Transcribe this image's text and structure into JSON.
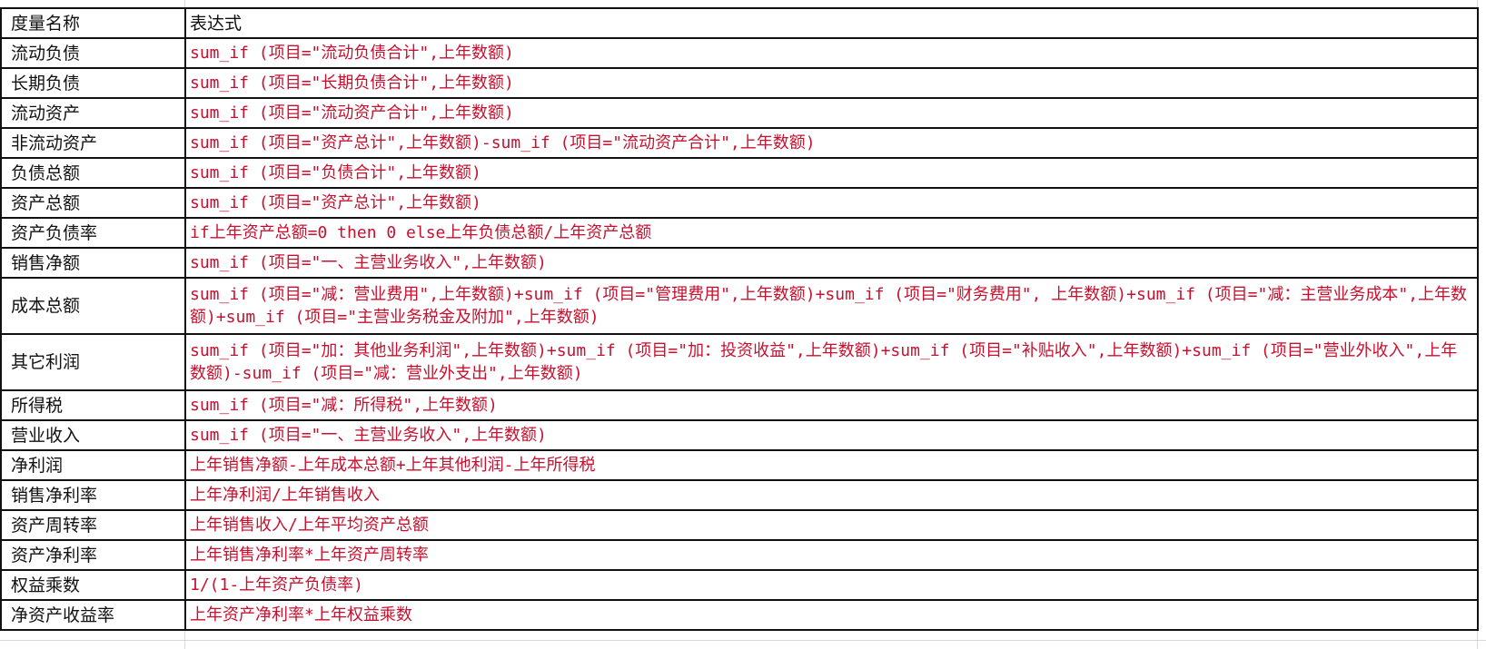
{
  "header": {
    "col1": "度量名称",
    "col2": "表达式"
  },
  "rows": [
    {
      "name": "流动负债",
      "expr": "sum_if (项目=\"流动负债合计\",上年数额)"
    },
    {
      "name": "长期负债",
      "expr": "sum_if (项目=\"长期负债合计\",上年数额)"
    },
    {
      "name": "流动资产",
      "expr": "sum_if (项目=\"流动资产合计\",上年数额)"
    },
    {
      "name": "非流动资产",
      "expr": "sum_if (项目=\"资产总计\",上年数额)-sum_if (项目=\"流动资产合计\",上年数额)"
    },
    {
      "name": "负债总额",
      "expr": "sum_if (项目=\"负债合计\",上年数额)"
    },
    {
      "name": "资产总额",
      "expr": "sum_if (项目=\"资产总计\",上年数额)"
    },
    {
      "name": "资产负债率",
      "expr": "if上年资产总额=0 then 0 else上年负债总额/上年资产总额"
    },
    {
      "name": "销售净额",
      "expr": "sum_if (项目=\"一、主营业务收入\",上年数额)"
    },
    {
      "name": "成本总额",
      "expr": "sum_if (项目=\"减：营业费用\",上年数额)+sum_if (项目=\"管理费用\",上年数额)+sum_if (项目=\"财务费用\", 上年数额)+sum_if (项目=\"减：主营业务成本\",上年数额)+sum_if (项目=\"主营业务税金及附加\",上年数额)"
    },
    {
      "name": "其它利润",
      "expr": "sum_if (项目=\"加：其他业务利润\",上年数额)+sum_if (项目=\"加：投资收益\",上年数额)+sum_if (项目=\"补贴收入\",上年数额)+sum_if (项目=\"营业外收入\",上年数额)-sum_if (项目=\"减：营业外支出\",上年数额)"
    },
    {
      "name": "所得税",
      "expr": "sum_if (项目=\"减：所得税\",上年数额)"
    },
    {
      "name": "营业收入",
      "expr": "sum_if (项目=\"一、主营业务收入\",上年数额)"
    },
    {
      "name": "净利润",
      "expr": "上年销售净额-上年成本总额+上年其他利润-上年所得税"
    },
    {
      "name": "销售净利率",
      "expr": "上年净利润/上年销售收入"
    },
    {
      "name": "资产周转率",
      "expr": "上年销售收入/上年平均资产总额"
    },
    {
      "name": "资产净利率",
      "expr": "上年销售净利率*上年资产周转率"
    },
    {
      "name": "权益乘数",
      "expr": "1/(1-上年资产负债率)"
    },
    {
      "name": "净资产收益率",
      "expr": "上年资产净利率*上年权益乘数"
    }
  ]
}
